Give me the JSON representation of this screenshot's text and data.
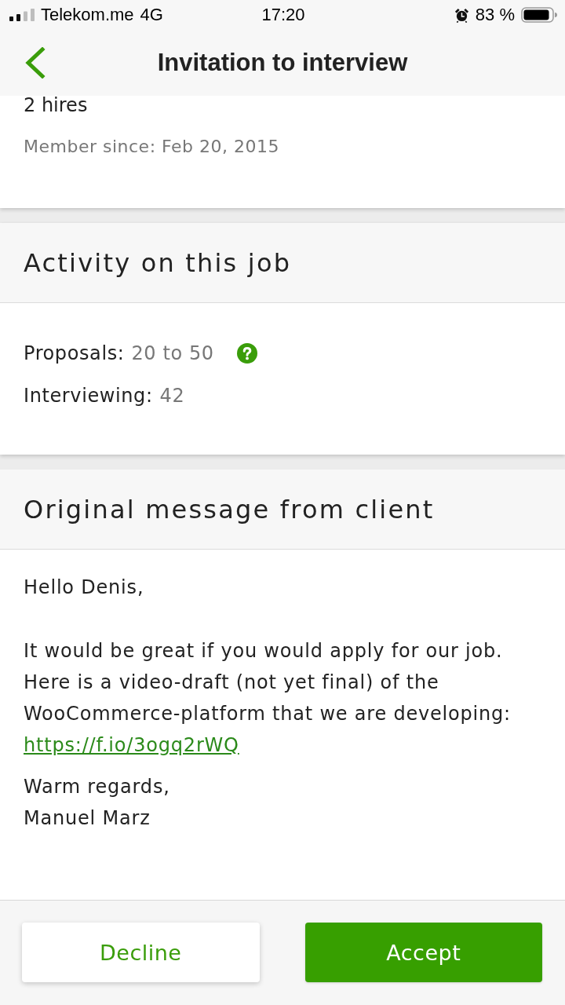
{
  "status_bar": {
    "carrier": "Telekom.me",
    "network": "4G",
    "time": "17:20",
    "battery": "83 %"
  },
  "nav": {
    "title": "Invitation to interview"
  },
  "client_card": {
    "lines": [
      {
        "kind": "primary",
        "text": "2 hires"
      },
      {
        "kind": "secondary",
        "text": "Member since: Feb 20, 2015"
      }
    ]
  },
  "sections": [
    {
      "kind": "stats",
      "title": "Activity on this job",
      "stats": [
        {
          "label": "Proposals:",
          "value": "20 to 50",
          "help": true
        },
        {
          "label": "Interviewing:",
          "value": "42",
          "help": false
        }
      ]
    },
    {
      "kind": "message",
      "title": "Original message from client",
      "paragraphs": [
        {
          "text": "Hello Denis,"
        },
        {
          "text": "It would be great if you would apply for our job.\nHere is a video-draft (not yet final) of the\nWooCommerce-platform that we are developing:",
          "link": "https://f.io/3ogq2rWQ"
        },
        {
          "text": "Warm regards,\nManuel Marz"
        }
      ]
    }
  ],
  "actions": [
    {
      "kind": "secondary",
      "label": "Decline"
    },
    {
      "kind": "primary",
      "label": "Accept"
    }
  ]
}
